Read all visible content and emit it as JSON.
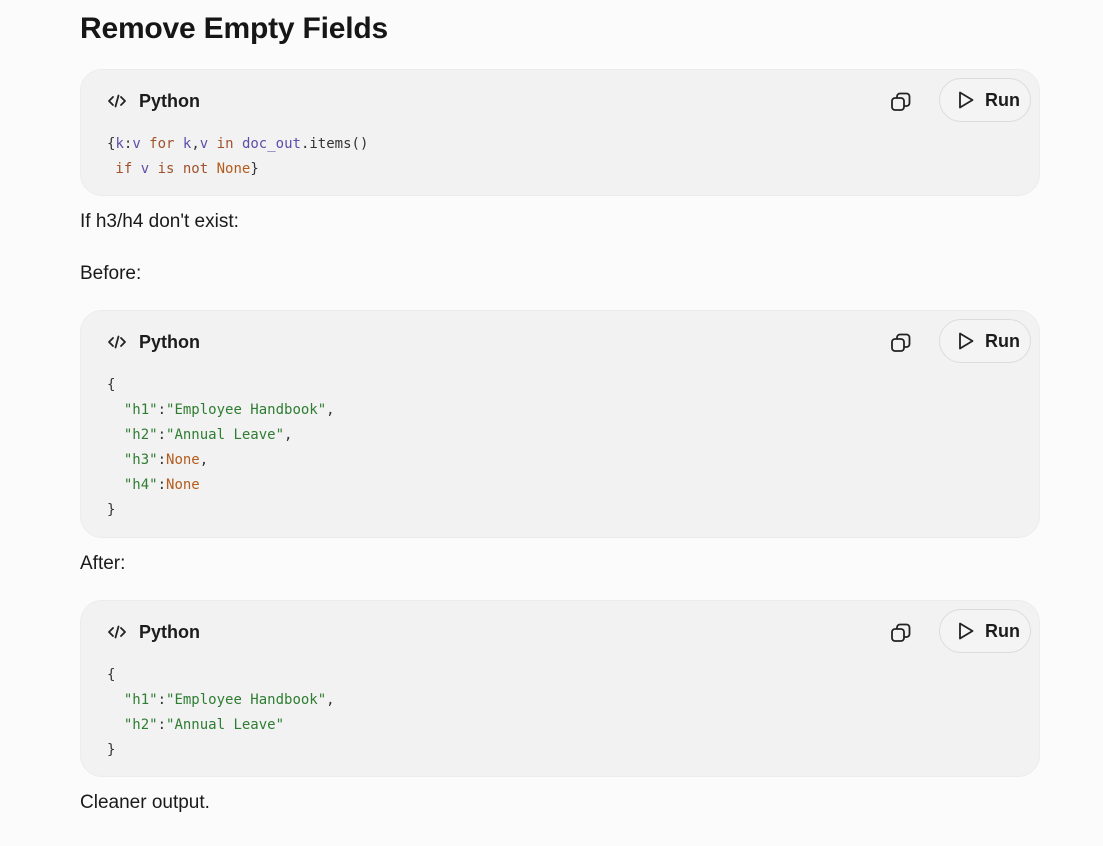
{
  "heading": "Remove Empty Fields",
  "paragraphs": {
    "if_missing": "If h3/h4 don't exist:",
    "before": "Before:",
    "after": "After:",
    "closing": "Cleaner output."
  },
  "code_blocks": [
    {
      "language": "Python",
      "run_label": "Run",
      "lines": [
        [
          {
            "t": "{",
            "c": "plain"
          },
          {
            "t": "k",
            "c": "var"
          },
          {
            "t": ":",
            "c": "plain"
          },
          {
            "t": "v",
            "c": "var"
          },
          {
            "t": " for ",
            "c": "kw"
          },
          {
            "t": "k",
            "c": "var"
          },
          {
            "t": ",",
            "c": "plain"
          },
          {
            "t": "v",
            "c": "var"
          },
          {
            "t": " in ",
            "c": "kw"
          },
          {
            "t": "doc_out",
            "c": "var"
          },
          {
            "t": ".items()",
            "c": "plain"
          }
        ],
        [
          {
            "t": " if ",
            "c": "kw"
          },
          {
            "t": "v",
            "c": "var"
          },
          {
            "t": " is not ",
            "c": "kw"
          },
          {
            "t": "None",
            "c": "none"
          },
          {
            "t": "}",
            "c": "plain"
          }
        ]
      ]
    },
    {
      "language": "Python",
      "run_label": "Run",
      "lines": [
        [
          {
            "t": "{",
            "c": "plain"
          }
        ],
        [
          {
            "t": "  ",
            "c": "plain"
          },
          {
            "t": "\"h1\"",
            "c": "key"
          },
          {
            "t": ":",
            "c": "plain"
          },
          {
            "t": "\"Employee Handbook\"",
            "c": "key"
          },
          {
            "t": ",",
            "c": "plain"
          }
        ],
        [
          {
            "t": "  ",
            "c": "plain"
          },
          {
            "t": "\"h2\"",
            "c": "key"
          },
          {
            "t": ":",
            "c": "plain"
          },
          {
            "t": "\"Annual Leave\"",
            "c": "key"
          },
          {
            "t": ",",
            "c": "plain"
          }
        ],
        [
          {
            "t": "  ",
            "c": "plain"
          },
          {
            "t": "\"h3\"",
            "c": "key"
          },
          {
            "t": ":",
            "c": "plain"
          },
          {
            "t": "None",
            "c": "none"
          },
          {
            "t": ",",
            "c": "plain"
          }
        ],
        [
          {
            "t": "  ",
            "c": "plain"
          },
          {
            "t": "\"h4\"",
            "c": "key"
          },
          {
            "t": ":",
            "c": "plain"
          },
          {
            "t": "None",
            "c": "none"
          }
        ],
        [
          {
            "t": "}",
            "c": "plain"
          }
        ]
      ]
    },
    {
      "language": "Python",
      "run_label": "Run",
      "lines": [
        [
          {
            "t": "{",
            "c": "plain"
          }
        ],
        [
          {
            "t": "  ",
            "c": "plain"
          },
          {
            "t": "\"h1\"",
            "c": "key"
          },
          {
            "t": ":",
            "c": "plain"
          },
          {
            "t": "\"Employee Handbook\"",
            "c": "key"
          },
          {
            "t": ",",
            "c": "plain"
          }
        ],
        [
          {
            "t": "  ",
            "c": "plain"
          },
          {
            "t": "\"h2\"",
            "c": "key"
          },
          {
            "t": ":",
            "c": "plain"
          },
          {
            "t": "\"Annual Leave\"",
            "c": "key"
          }
        ],
        [
          {
            "t": "}",
            "c": "plain"
          }
        ]
      ]
    }
  ],
  "icons": {
    "language": "code-icon",
    "copy": "copy-icon",
    "run": "play-icon"
  },
  "colors": {
    "string": "#2e7d32",
    "none": "#b35c1e",
    "keyword": "#a0522d",
    "variable": "#5e4da8",
    "card_background": "#f2f2f2"
  }
}
